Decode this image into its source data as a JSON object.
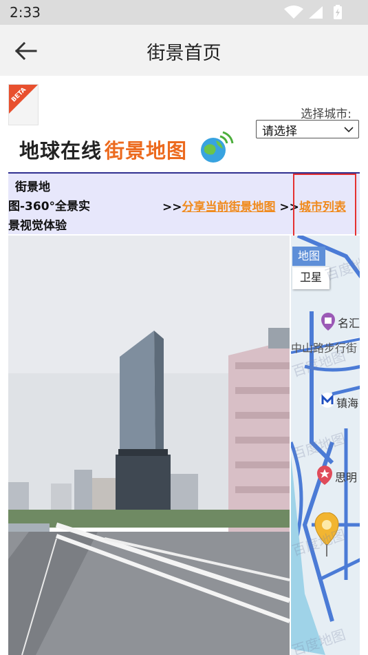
{
  "status_bar": {
    "time": "2:33"
  },
  "app_bar": {
    "title": "街景首页"
  },
  "header": {
    "beta_label": "BETA",
    "city_label": "选择城市:",
    "city_select_value": "请选择",
    "logo_text_a": "地球在线",
    "logo_text_b": "街景地图"
  },
  "nav": {
    "desc_line1": "街景地",
    "desc_line2": "图-360°全景实",
    "desc_line3": "景视觉体验",
    "sep1": ">>",
    "share_link": "分享当前街景地图",
    "sep2": ">>",
    "city_list_link": "城市列表"
  },
  "map": {
    "tab_map": "地图",
    "tab_satellite": "卫星",
    "poi1": "名汇",
    "poi2": "中山路步行街",
    "poi3": "镇海",
    "poi4": "思明",
    "watermark": "百度地图"
  },
  "colors": {
    "accent_orange": "#f08a1c",
    "nav_bg": "#e7e7fb",
    "highlight_red": "#e53030",
    "map_tab_blue": "#5e8fd8"
  }
}
